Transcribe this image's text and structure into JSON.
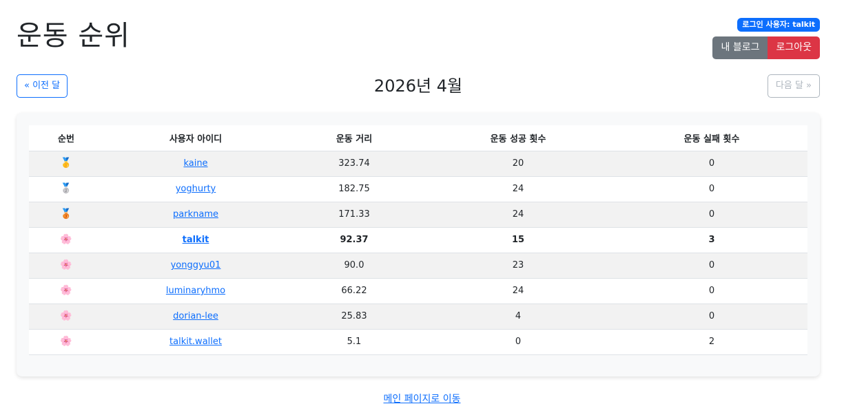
{
  "header": {
    "title": "운동 순위",
    "login_badge": "로그인 사용자: talkit",
    "my_blog_label": "내 블로그",
    "logout_label": "로그아웃"
  },
  "nav": {
    "prev_label": "« 이전 달",
    "month": "2026년 4월",
    "next_label": "다음 달 »"
  },
  "table": {
    "columns": [
      "순번",
      "사용자 아이디",
      "운동 거리",
      "운동 성공 횟수",
      "운동 실패 횟수"
    ],
    "rows": [
      {
        "rank_icon": "🥇",
        "rank_icon_name": "gold-medal-icon",
        "user": "kaine",
        "distance": "323.74",
        "success": "20",
        "fail": "0"
      },
      {
        "rank_icon": "🥈",
        "rank_icon_name": "silver-medal-icon",
        "user": "yoghurty",
        "distance": "182.75",
        "success": "24",
        "fail": "0"
      },
      {
        "rank_icon": "🥉",
        "rank_icon_name": "bronze-medal-icon",
        "user": "parkname",
        "distance": "171.33",
        "success": "24",
        "fail": "0"
      },
      {
        "rank_icon": "🌸",
        "rank_icon_name": "cherry-blossom-icon",
        "user": "talkit",
        "distance": "92.37",
        "success": "15",
        "fail": "3"
      },
      {
        "rank_icon": "🌸",
        "rank_icon_name": "cherry-blossom-icon",
        "user": "yonggyu01",
        "distance": "90.0",
        "success": "23",
        "fail": "0"
      },
      {
        "rank_icon": "🌸",
        "rank_icon_name": "cherry-blossom-icon",
        "user": "luminaryhmo",
        "distance": "66.22",
        "success": "24",
        "fail": "0"
      },
      {
        "rank_icon": "🌸",
        "rank_icon_name": "cherry-blossom-icon",
        "user": "dorian-lee",
        "distance": "25.83",
        "success": "4",
        "fail": "0"
      },
      {
        "rank_icon": "🌸",
        "rank_icon_name": "cherry-blossom-icon",
        "user": "talkit.wallet",
        "distance": "5.1",
        "success": "0",
        "fail": "2"
      }
    ]
  },
  "footer": {
    "main_link": "메인 페이지로 이동"
  },
  "colors": {
    "primary": "#0d6efd",
    "secondary": "#6c757d",
    "danger": "#dc3545"
  }
}
